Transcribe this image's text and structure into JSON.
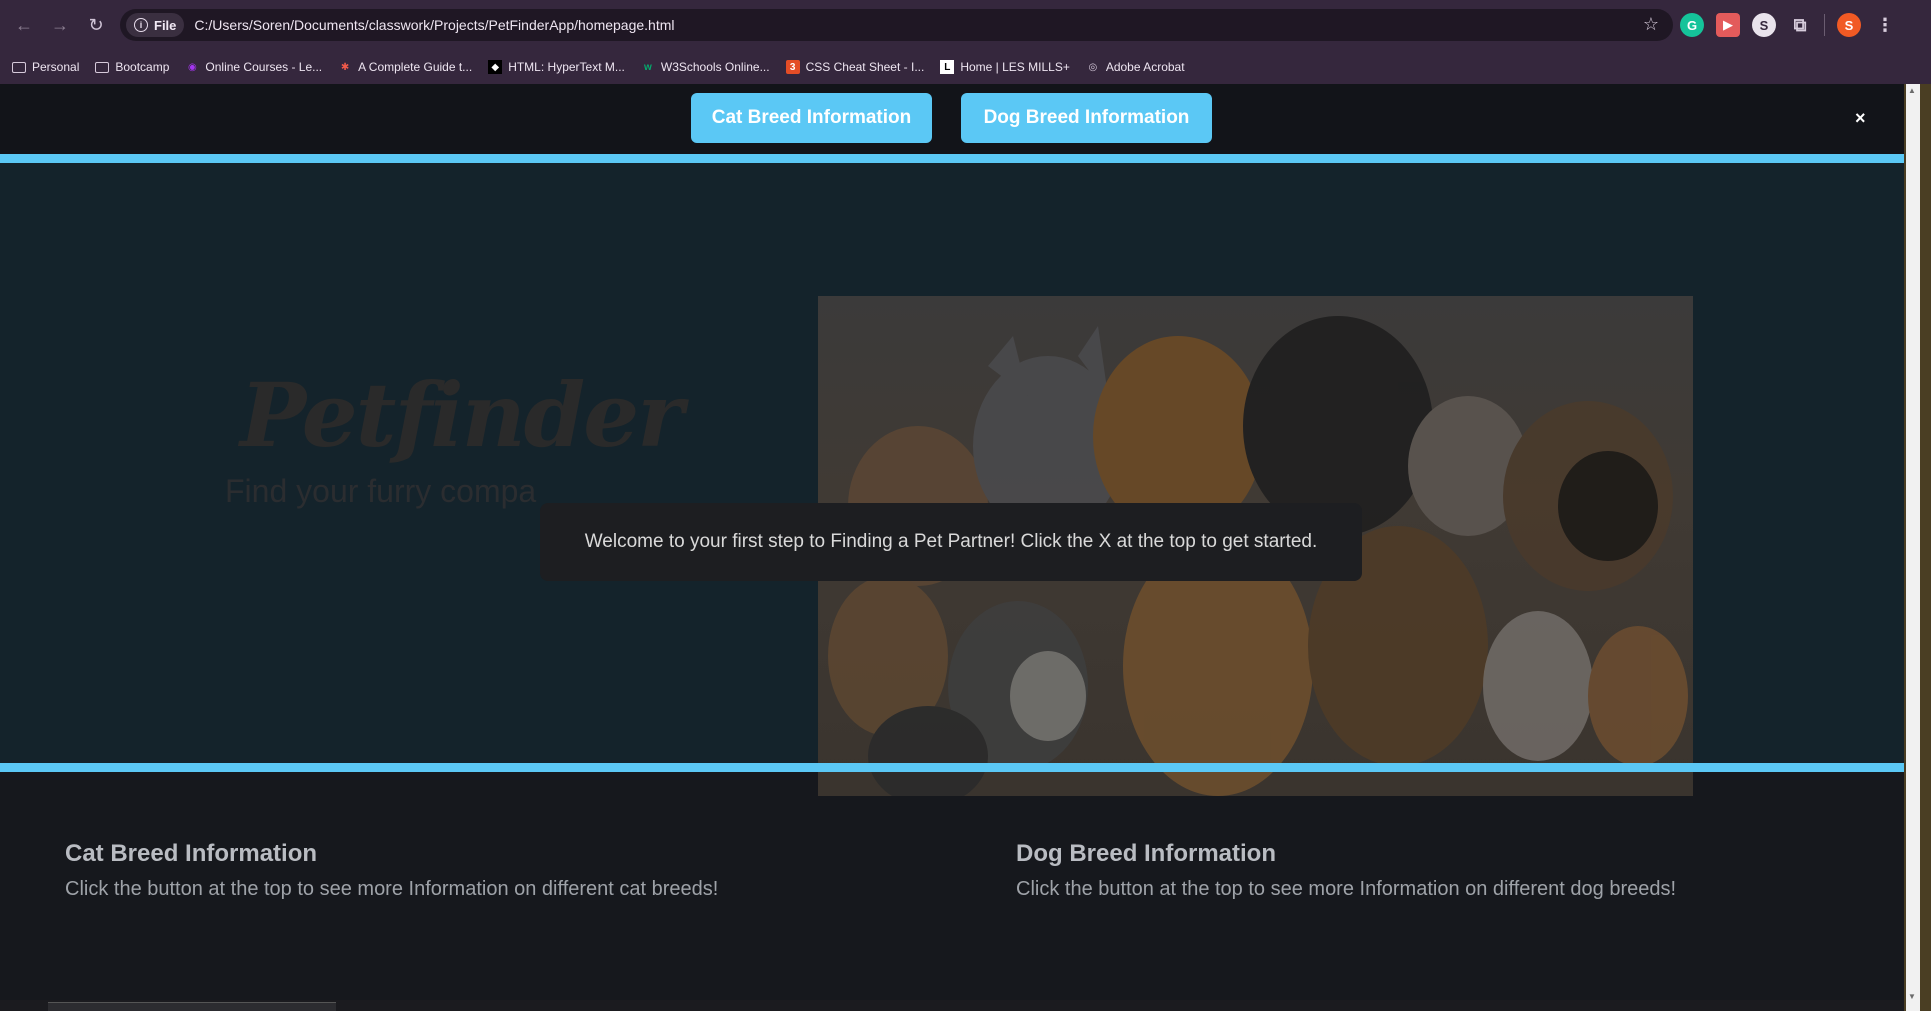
{
  "browser": {
    "file_chip": "File",
    "url": "C:/Users/Soren/Documents/classwork/Projects/PetFinderApp/homepage.html",
    "avatar_letter": "S",
    "bookmarks": [
      {
        "label": "Personal",
        "icon": "folder-icon"
      },
      {
        "label": "Bootcamp",
        "icon": "folder-icon"
      },
      {
        "label": "Online Courses - Le...",
        "icon": "udemy-icon"
      },
      {
        "label": "A Complete Guide t...",
        "icon": "star-logo-icon"
      },
      {
        "label": "HTML: HyperText M...",
        "icon": "mdn-icon"
      },
      {
        "label": "W3Schools Online...",
        "icon": "w3schools-icon"
      },
      {
        "label": "CSS Cheat Sheet - I...",
        "icon": "css-icon"
      },
      {
        "label": "Home | LES MILLS+",
        "icon": "lesmills-icon"
      },
      {
        "label": "Adobe Acrobat",
        "icon": "globe-icon"
      }
    ]
  },
  "nav": {
    "cat_button": "Cat Breed Information",
    "dog_button": "Dog Breed Information",
    "close": "×"
  },
  "hero": {
    "logo": "Petfinder",
    "tagline": "Find your furry compa",
    "tooltip": "Welcome to your first step to Finding a Pet Partner! Click the X at the top to get started."
  },
  "info": {
    "cat_title": "Cat Breed Information",
    "cat_text": "Click the button at the top to see more Information on different cat breeds!",
    "dog_title": "Dog Breed Information",
    "dog_text": "Click the button at the top to see more Information on different dog breeds!"
  },
  "colors": {
    "accent": "#5bc8f5",
    "hero_bg": "#14232b",
    "page_bg": "#16181d",
    "chrome": "#35273d"
  }
}
